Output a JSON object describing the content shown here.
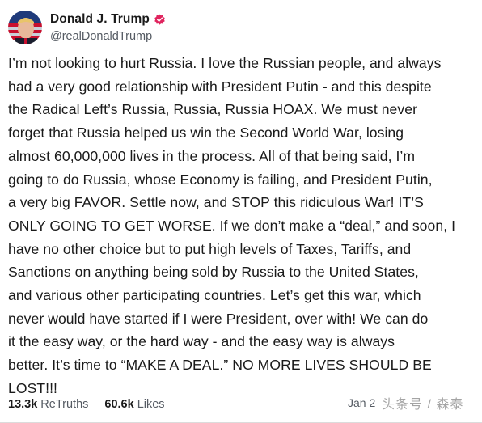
{
  "author": {
    "display_name": "Donald J. Trump",
    "handle": "@realDonaldTrump",
    "verified_badge_color": "#e0245e"
  },
  "post": {
    "lines": [
      "I’m not looking to hurt Russia. I love the Russian people, and always",
      "had a very good relationship with President Putin - and this despite",
      "the Radical Left’s Russia, Russia, Russia HOAX. We must never",
      "forget that Russia helped us win the Second World War, losing",
      "almost 60,000,000 lives in the process. All of that being said, I’m",
      "going to do Russia, whose Economy is failing, and President Putin,",
      "a very big FAVOR. Settle now, and STOP this ridiculous War! IT’S",
      "ONLY GOING TO GET WORSE. If we don’t make a “deal,” and soon, I",
      "have no other choice but to put high levels of Taxes, Tariffs, and",
      "Sanctions on anything being sold by Russia to the United States,",
      "and various other participating countries. Let’s get this war, which",
      "never would have started if I were President, over with! We can do",
      "it the easy way, or the hard way - and the easy way is always",
      "better. It’s time to “MAKE A DEAL.” NO MORE LIVES SHOULD BE",
      "LOST!!!"
    ]
  },
  "stats": {
    "retruths_value": "13.3k",
    "retruths_label": "ReTruths",
    "likes_value": "60.6k",
    "likes_label": "Likes",
    "date": "Jan 2"
  },
  "watermark": "头条号 / 森泰"
}
